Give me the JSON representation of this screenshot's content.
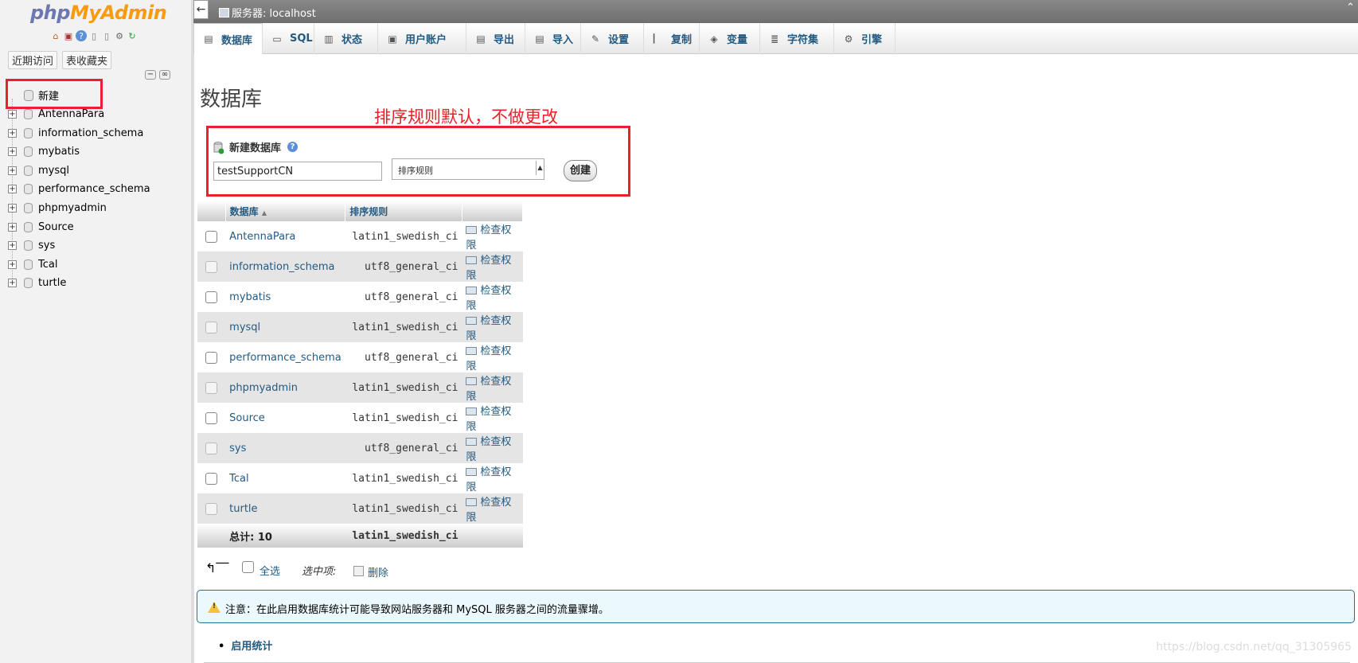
{
  "logo": {
    "part1": "php",
    "part2": "MyAdmin"
  },
  "sidebar": {
    "tabs": [
      "近期访问",
      "表收藏夹"
    ],
    "new_label": "新建",
    "databases": [
      "AntennaPara",
      "information_schema",
      "mybatis",
      "mysql",
      "performance_schema",
      "phpmyadmin",
      "Source",
      "sys",
      "Tcal",
      "turtle"
    ]
  },
  "topbar": {
    "back": "←",
    "breadcrumb": "服务器: localhost"
  },
  "menu": {
    "tabs": [
      {
        "label": "数据库",
        "icon": "database-icon"
      },
      {
        "label": "SQL",
        "icon": "sql-icon"
      },
      {
        "label": "状态",
        "icon": "status-icon"
      },
      {
        "label": "用户账户",
        "icon": "users-icon"
      },
      {
        "label": "导出",
        "icon": "export-icon"
      },
      {
        "label": "导入",
        "icon": "import-icon"
      },
      {
        "label": "设置",
        "icon": "settings-icon"
      },
      {
        "label": "复制",
        "icon": "replication-icon"
      },
      {
        "label": "变量",
        "icon": "variables-icon"
      },
      {
        "label": "字符集",
        "icon": "charset-icon"
      },
      {
        "label": "引擎",
        "icon": "engine-icon"
      }
    ]
  },
  "page": {
    "title": "数据库"
  },
  "annotation": "排序规则默认，不做更改",
  "create_form": {
    "label": "新建数据库",
    "dbname_value": "testSupportCN",
    "collation_selected": "排序规则",
    "create_button": "创建"
  },
  "table": {
    "headers": {
      "database": "数据库",
      "collation": "排序规则"
    },
    "check_priv_label": "检查权限",
    "rows": [
      {
        "name": "AntennaPara",
        "collation": "latin1_swedish_ci"
      },
      {
        "name": "information_schema",
        "collation": "utf8_general_ci"
      },
      {
        "name": "mybatis",
        "collation": "utf8_general_ci"
      },
      {
        "name": "mysql",
        "collation": "latin1_swedish_ci"
      },
      {
        "name": "performance_schema",
        "collation": "utf8_general_ci"
      },
      {
        "name": "phpmyadmin",
        "collation": "latin1_swedish_ci"
      },
      {
        "name": "Source",
        "collation": "latin1_swedish_ci"
      },
      {
        "name": "sys",
        "collation": "utf8_general_ci"
      },
      {
        "name": "Tcal",
        "collation": "latin1_swedish_ci"
      },
      {
        "name": "turtle",
        "collation": "latin1_swedish_ci"
      }
    ],
    "total_label": "总计: 10",
    "total_collation": "latin1_swedish_ci"
  },
  "footer": {
    "select_all": "全选",
    "with_selected": "选中项:",
    "delete": "删除"
  },
  "notice": {
    "text": "注意：在此启用数据库统计可能导致网站服务器和 MySQL 服务器之间的流量骤增。"
  },
  "enable_stats": "启用统计",
  "watermark": "https://blog.csdn.net/qq_31305965",
  "colors": {
    "link": "#235a81",
    "annotation": "#e8222a",
    "logo_php": "#6c78af",
    "logo_myadmin": "#f89c0e"
  }
}
